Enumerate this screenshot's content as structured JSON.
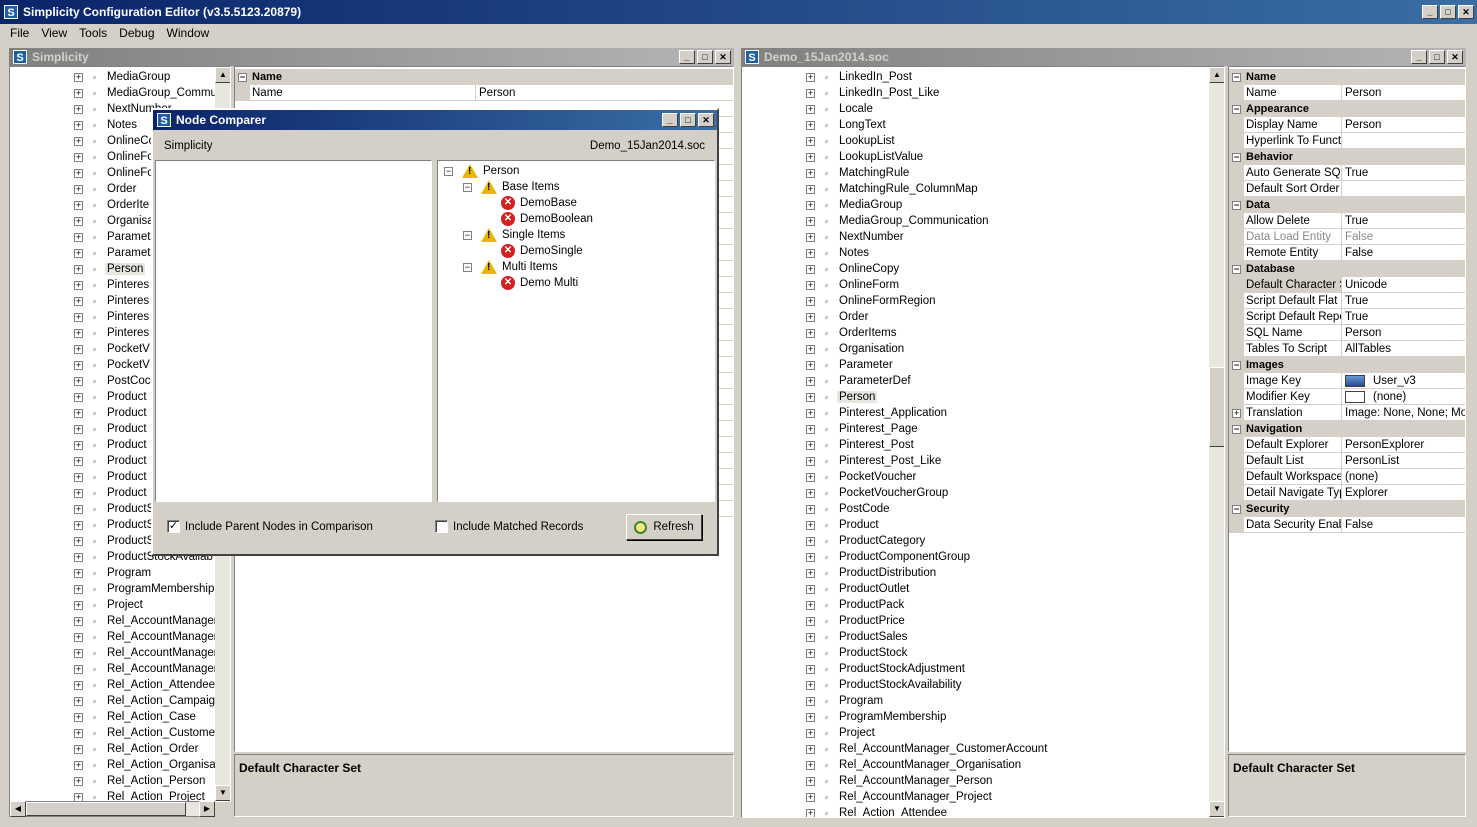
{
  "app": {
    "title": "Simplicity Configuration Editor (v3.5.5123.20879)"
  },
  "menu": [
    "File",
    "View",
    "Tools",
    "Debug",
    "Window"
  ],
  "left_window": {
    "title": "Simplicity",
    "tree": [
      "MediaGroup",
      "MediaGroup_Commur",
      "NextNumber",
      "Notes",
      "OnlineCo",
      "OnlineFo",
      "OnlineFo",
      "Order",
      "OrderIte",
      "Organisa",
      "Paramet",
      "Paramet",
      "Person",
      "Pinteres",
      "Pinteres",
      "Pinteres",
      "Pinteres",
      "PocketV",
      "PocketV",
      "PostCoc",
      "Product",
      "Product",
      "Product",
      "Product",
      "Product",
      "Product",
      "Product",
      "ProductS",
      "ProductS",
      "ProductS",
      "ProductStockAvailab",
      "Program",
      "ProgramMembership",
      "Project",
      "Rel_AccountManager",
      "Rel_AccountManager",
      "Rel_AccountManager",
      "Rel_AccountManager",
      "Rel_Action_Attendee",
      "Rel_Action_Campaigr",
      "Rel_Action_Case",
      "Rel_Action_Customer",
      "Rel_Action_Order",
      "Rel_Action_Organisat",
      "Rel_Action_Person",
      "Rel_Action_Project"
    ],
    "selected_index": 12,
    "props_header": "Name",
    "props_first": {
      "name": "Name",
      "value": "Person"
    },
    "description": "Default Character Set"
  },
  "right_window": {
    "title": "Demo_15Jan2014.soc",
    "tree": [
      "LinkedIn_Post",
      "LinkedIn_Post_Like",
      "Locale",
      "LongText",
      "LookupList",
      "LookupListValue",
      "MatchingRule",
      "MatchingRule_ColumnMap",
      "MediaGroup",
      "MediaGroup_Communication",
      "NextNumber",
      "Notes",
      "OnlineCopy",
      "OnlineForm",
      "OnlineFormRegion",
      "Order",
      "OrderItems",
      "Organisation",
      "Parameter",
      "ParameterDef",
      "Person",
      "Pinterest_Application",
      "Pinterest_Page",
      "Pinterest_Post",
      "Pinterest_Post_Like",
      "PocketVoucher",
      "PocketVoucherGroup",
      "PostCode",
      "Product",
      "ProductCategory",
      "ProductComponentGroup",
      "ProductDistribution",
      "ProductOutlet",
      "ProductPack",
      "ProductPrice",
      "ProductSales",
      "ProductStock",
      "ProductStockAdjustment",
      "ProductStockAvailability",
      "Program",
      "ProgramMembership",
      "Project",
      "Rel_AccountManager_CustomerAccount",
      "Rel_AccountManager_Organisation",
      "Rel_AccountManager_Person",
      "Rel_AccountManager_Project",
      "Rel_Action_Attendee"
    ],
    "selected_index": 20,
    "properties": [
      {
        "category": "Name",
        "rows": [
          {
            "name": "Name",
            "value": "Person"
          }
        ]
      },
      {
        "category": "Appearance",
        "rows": [
          {
            "name": "Display Name",
            "value": "Person"
          },
          {
            "name": "Hyperlink To Functi",
            "value": ""
          }
        ]
      },
      {
        "category": "Behavior",
        "rows": [
          {
            "name": "Auto Generate SQL",
            "value": "True"
          },
          {
            "name": "Default Sort Order",
            "value": ""
          }
        ]
      },
      {
        "category": "Data",
        "rows": [
          {
            "name": "Allow Delete",
            "value": "True"
          },
          {
            "name": "Data Load Entity",
            "value": "False",
            "dim": true
          },
          {
            "name": "Remote Entity",
            "value": "False"
          }
        ]
      },
      {
        "category": "Database",
        "rows": [
          {
            "name": "Default Character S",
            "value": "Unicode",
            "highlight": true
          },
          {
            "name": "Script Default Flat L",
            "value": "True"
          },
          {
            "name": "Script Default Repo",
            "value": "True"
          },
          {
            "name": "SQL Name",
            "value": "Person"
          },
          {
            "name": "Tables To Script",
            "value": "AllTables"
          }
        ]
      },
      {
        "category": "Images",
        "rows": [
          {
            "name": "Image Key",
            "value": "User_v3",
            "icon": "user-image"
          },
          {
            "name": "Modifier Key",
            "value": "(none)",
            "icon": "blank-image"
          },
          {
            "name": "Translation",
            "value": "Image: None, None; Mod",
            "expandable": true
          }
        ]
      },
      {
        "category": "Navigation",
        "rows": [
          {
            "name": "Default Explorer",
            "value": "PersonExplorer"
          },
          {
            "name": "Default List",
            "value": "PersonList"
          },
          {
            "name": "Default Workspace",
            "value": "(none)"
          },
          {
            "name": "Detail Navigate Typ",
            "value": "Explorer"
          }
        ]
      },
      {
        "category": "Security",
        "rows": [
          {
            "name": "Data Security Enabl",
            "value": "False"
          }
        ]
      }
    ],
    "description": "Default Character Set"
  },
  "dialog": {
    "title": "Node Comparer",
    "left_label": "Simplicity",
    "right_label": "Demo_15Jan2014.soc",
    "tree": [
      {
        "label": "Person",
        "icon": "warning",
        "level": 0,
        "expander": true
      },
      {
        "label": "Base Items",
        "icon": "warning",
        "level": 1,
        "expander": true
      },
      {
        "label": "DemoBase",
        "icon": "error",
        "level": 2
      },
      {
        "label": "DemoBoolean",
        "icon": "error",
        "level": 2
      },
      {
        "label": "Single Items",
        "icon": "warning",
        "level": 1,
        "expander": true
      },
      {
        "label": "DemoSingle",
        "icon": "error",
        "level": 2
      },
      {
        "label": "Multi Items",
        "icon": "warning",
        "level": 1,
        "expander": true
      },
      {
        "label": "Demo Multi",
        "icon": "error",
        "level": 2
      }
    ],
    "include_parent_label": "Include Parent Nodes in Comparison",
    "include_parent_checked": true,
    "include_matched_label": "Include Matched Records",
    "include_matched_checked": false,
    "refresh_label": "Refresh"
  },
  "colors": {
    "titlebar_active": "#0a246a",
    "titlebar_inactive": "#808080",
    "window_bg": "#d4d0c8"
  }
}
